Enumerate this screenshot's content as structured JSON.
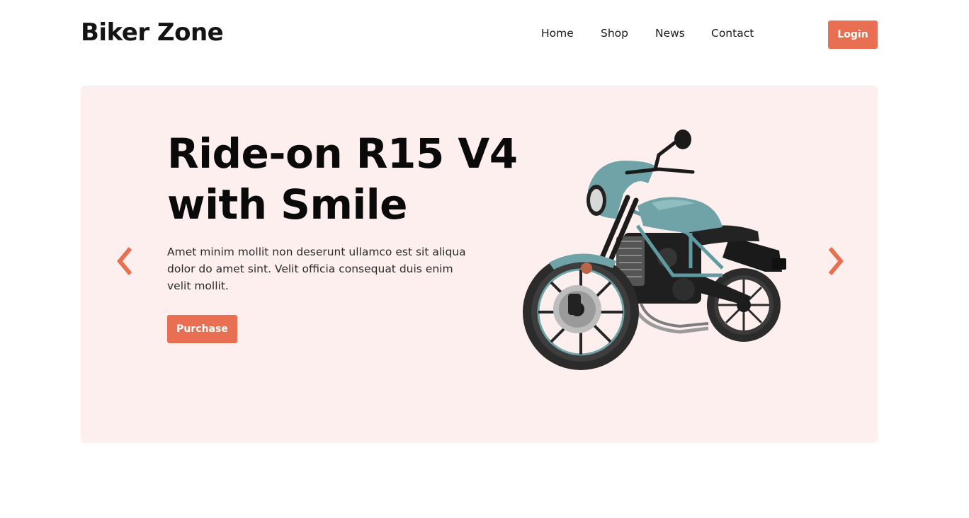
{
  "brand": {
    "name": "Biker Zone"
  },
  "nav": {
    "items": [
      {
        "label": "Home"
      },
      {
        "label": "Shop"
      },
      {
        "label": "News"
      },
      {
        "label": "Contact"
      }
    ],
    "login_label": "Login"
  },
  "hero": {
    "title_line1": "Ride-on R15 V4",
    "title_line2": "with Smile",
    "description": "Amet minim mollit non deserunt ullamco est sit aliqua dolor do amet sint. Velit officia consequat duis enim velit mollit.",
    "purchase_label": "Purchase",
    "image_subject": "motorcycle",
    "prev_icon": "chevron-left-icon",
    "next_icon": "chevron-right-icon"
  },
  "colors": {
    "accent": "#e86f52",
    "hero_background": "#fdefed",
    "text": "#111111",
    "bike_body": "#6fa3a8"
  }
}
